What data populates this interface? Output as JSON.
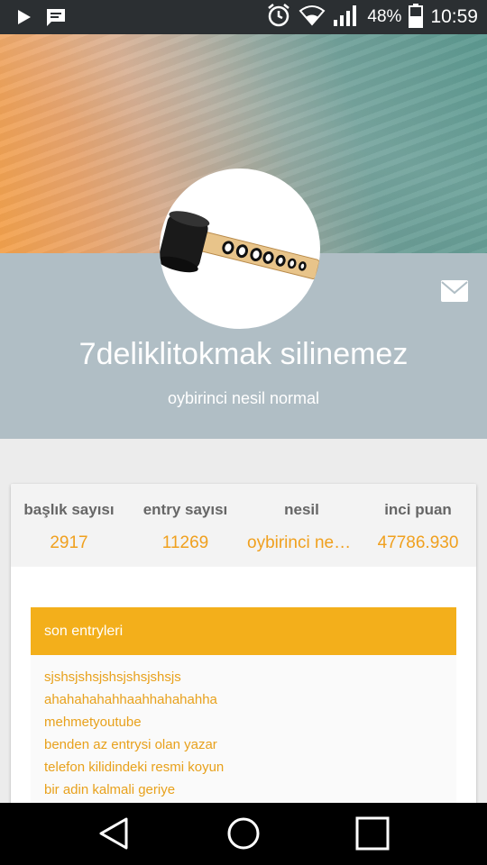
{
  "status_bar": {
    "battery": "48%",
    "time": "10:59",
    "icons": [
      "play-icon",
      "message-icon",
      "alarm-icon",
      "wifi-icon",
      "signal-icon",
      "battery-icon"
    ]
  },
  "profile": {
    "username": "7deliklitokmak silinemez",
    "generation": "oybirinci nesil normal",
    "avatar": "mallet-icon"
  },
  "stats": [
    {
      "label": "başlık sayısı",
      "value": "2917"
    },
    {
      "label": "entry sayısı",
      "value": "11269"
    },
    {
      "label": "nesil",
      "value": "oybirinci nesil normal"
    },
    {
      "label": "inci puan",
      "value": "47786.930"
    }
  ],
  "entries": {
    "header": "son entryleri",
    "items": [
      "sjshsjshsjshsjshsjshsjs",
      "ahahahahahhaahhahahahha",
      "mehmetyoutube",
      "benden az entrysi olan yazar",
      "telefon kilidindeki resmi koyun",
      "bir adin kalmali geriye"
    ]
  },
  "colors": {
    "accent": "#f3af1b",
    "stat_value": "#f0a01e",
    "profile_band": "#b0bec5",
    "status_bar": "#2b2f32"
  }
}
